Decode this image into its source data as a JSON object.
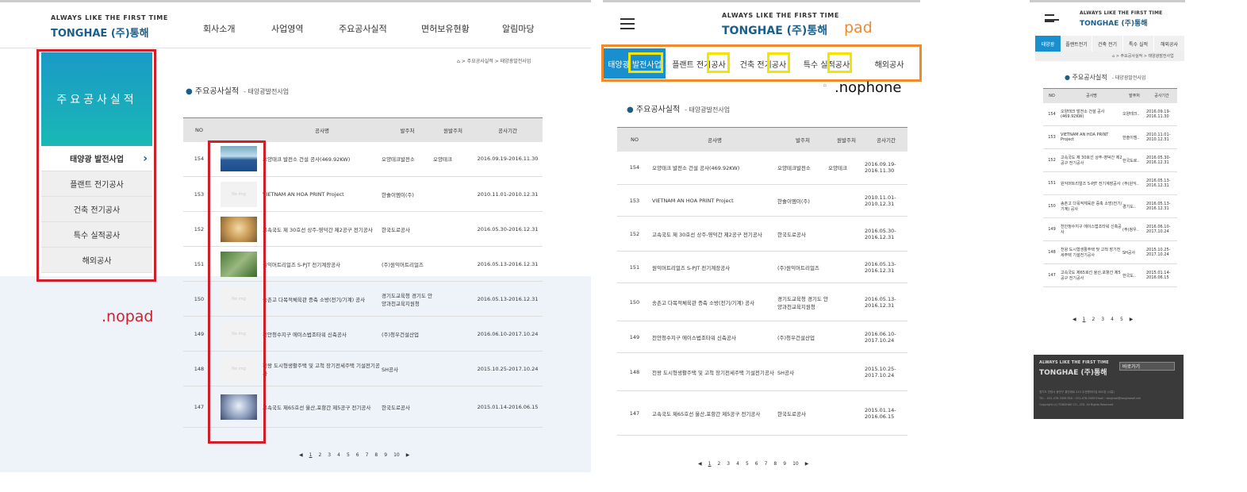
{
  "brand": {
    "tagline": "ALWAYS LIKE THE FIRST TIME",
    "name": "TONGHAE",
    "name_kr": "(주)통해"
  },
  "nav": [
    "회사소개",
    "사업영역",
    "주요공사실적",
    "면허보유현황",
    "알림마당"
  ],
  "sidebar": {
    "title": "주요공사실적",
    "items": [
      "태양광 발전사업",
      "플랜트 전기공사",
      "건축 전기공사",
      "특수 실적공사",
      "해외공사"
    ]
  },
  "breadcrumb": {
    "path": "> 주요공사실적 > 태양광발전사업",
    "path_phone": "> 주요공사실적 > 태양광발전사업"
  },
  "page": {
    "title": "주요공사실적",
    "subtitle": "- 태양광발전사업",
    "subtitle_phone": "- 태양광발전사업"
  },
  "table": {
    "headers": [
      "NO",
      "공사명",
      "발주처",
      "원발주처",
      "공사기간"
    ],
    "no_img": "No img",
    "rows": [
      {
        "no": "154",
        "name": "오양태크 발전소 건설 공사(469.92KW)",
        "client": "오양테크발전소",
        "orig": "오양테크",
        "period": "2016.09.19-2016.11.30",
        "period_a": "2016.09.19-",
        "period_b": "2016.11.30",
        "img": "solar"
      },
      {
        "no": "153",
        "name": "VIETNAM AN HOA PRINT Project",
        "client": "한솔이엠이(주)",
        "orig": "",
        "period": "2010.11.01-2010.12.31",
        "period_a": "2010.11.01-",
        "period_b": "2010.12.31",
        "img": "none"
      },
      {
        "no": "152",
        "name": "고속국도 제 30호선 상주-영덕간 제2공구 전기공사",
        "client": "한국도로공사",
        "orig": "",
        "period": "2016.05.30-2016.12.31",
        "period_a": "2016.05.30-",
        "period_b": "2016.12.31",
        "img": "tunnel"
      },
      {
        "no": "151",
        "name": "원익머트리얼즈 S-PJT 전기계장공사",
        "client": "(주)원익머트리얼즈",
        "orig": "",
        "period": "2016.05.13-2016.12.31",
        "period_a": "2016.05.13-",
        "period_b": "2016.12.31",
        "img": "aerial"
      },
      {
        "no": "150",
        "name": "송촌고 다목적체육관 증축 소방(전기/기계) 공사",
        "client": "경기도교육청 경기도 안양과천교육지원청",
        "orig": "",
        "period": "2016.05.13-2016.12.31",
        "period_a": "2016.05.13-",
        "period_b": "2016.12.31",
        "img": "none"
      },
      {
        "no": "149",
        "name": "천안청수지구 에이스법조타워 신축공사",
        "client": "(주)청우건설산업",
        "orig": "",
        "period": "2016.06.10-2017.10.24",
        "period_a": "2016.06.10-",
        "period_b": "2017.10.24",
        "img": "none"
      },
      {
        "no": "148",
        "name": "천왕 도시형생활주택 및 고척 장기전세주택 기설전기공사",
        "client": "SH공사",
        "orig": "",
        "period": "2015.10.25-2017.10.24",
        "period_a": "2015.10.25-",
        "period_b": "2017.10.24",
        "img": "none"
      },
      {
        "no": "147",
        "name": "고속국도 제65호선 울산,포항간 제5공구 전기공사",
        "client": "한국도로공사",
        "orig": "",
        "period": "2015.01.14-2016.06.15",
        "period_a": "2015.01.14-",
        "period_b": "2016.06.15",
        "img": "tunnel2"
      }
    ]
  },
  "pager": {
    "prev": "◀",
    "next": "▶",
    "pages": [
      "1",
      "2",
      "3",
      "4",
      "5",
      "6",
      "7",
      "8",
      "9",
      "10"
    ],
    "pages_phone": [
      "1",
      "2",
      "3",
      "4",
      "5"
    ]
  },
  "pad_tabs": [
    "태양광 발전사업",
    "플랜트 전기공사",
    "건축 전기공사",
    "특수 실적공사",
    "해외공사"
  ],
  "phone_tabs": [
    "태양광",
    "플랜트전기",
    "건축 전기",
    "특수 실적",
    "해외공사"
  ],
  "phone_rows": [
    {
      "no": "154",
      "name": "오양태크 발전소 건설 공사(469.92KW)",
      "client": "오양테크..",
      "p1": "2016.09.19-",
      "p2": "2016.11.30"
    },
    {
      "no": "153",
      "name": "VIETNAM AN HOA PRINT Project",
      "client": "한솔이엠..",
      "p1": "2010.11.01-",
      "p2": "2010.12.31"
    },
    {
      "no": "152",
      "name": "고속국도 제 30호선 상주-영덕간 제2공구 전기공사",
      "client": "한국도로..",
      "p1": "2016.05.30-",
      "p2": "2016.12.31"
    },
    {
      "no": "151",
      "name": "원익머트리얼즈 S-PJT 전기계장공사",
      "client": "(주)원익..",
      "p1": "2016.05.13-",
      "p2": "2016.12.31"
    },
    {
      "no": "150",
      "name": "송촌고 다목적체육관 증축 소방(전기/기계) 공사",
      "client": "경기도..",
      "p1": "2016.05.13-",
      "p2": "2016.12.31"
    },
    {
      "no": "149",
      "name": "천안청수지구 에이스법조타워 신축공사",
      "client": "(주)청우..",
      "p1": "2016.06.10-",
      "p2": "2017.10.24"
    },
    {
      "no": "148",
      "name": "천왕 도시형생활주택 및 고척 장기전세주택 기설전기공사",
      "client": "SH공사",
      "p1": "2015.10.25-",
      "p2": "2017.10.24"
    },
    {
      "no": "147",
      "name": "고속국도 제65호선 울산,포항간 제5공구 전기공사",
      "client": "한국도..",
      "p1": "2015.01.14-",
      "p2": "2016.06.15"
    }
  ],
  "footer": {
    "go_label": "바로가기",
    "addr": "경기도 안양시 동안구 흥안대로 415 두산벤처다임 802호 (시흥)",
    "tel": "TEL : 031-478-3456   FAX : 031-478-3459   Email : tonghae@tonghaeall.net",
    "copy": "Copyright (c) TONGHAE CO., LTD. All Rights Reserved"
  },
  "annotations": {
    "nopad": ".nopad",
    "pad": "pad",
    "nophone": ".nophone"
  },
  "colors": {
    "brand": "#1a5f8a",
    "red_box": "#d11f2a",
    "orange_box": "#f08a2a",
    "yellow_box": "#f5e400",
    "active_tab": "#1a8fd0"
  }
}
